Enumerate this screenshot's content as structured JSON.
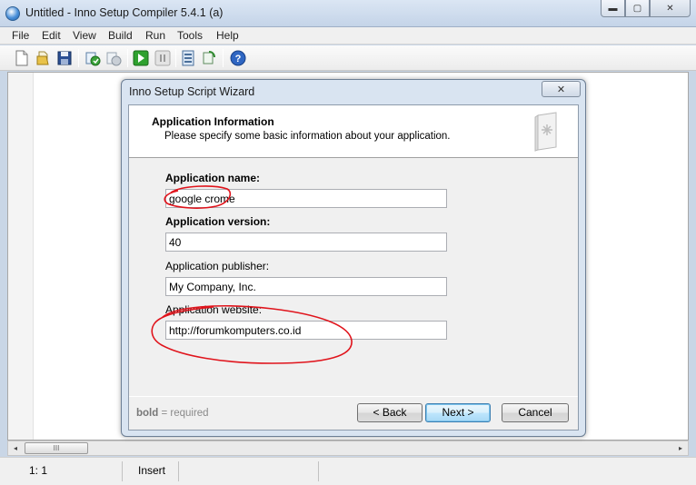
{
  "window": {
    "title": "Untitled - Inno Setup Compiler 5.4.1 (a)",
    "min_glyph": "▬",
    "max_glyph": "▢",
    "close_glyph": "✕"
  },
  "menu": [
    "File",
    "Edit",
    "View",
    "Build",
    "Run",
    "Tools",
    "Help"
  ],
  "toolbar": {
    "icons": [
      "new-file-icon",
      "open-folder-icon",
      "save-icon",
      "compile-icon",
      "stop-compile-icon",
      "run-icon",
      "pause-icon",
      "target-setup-icon",
      "target-uninstall-icon",
      "help-icon"
    ]
  },
  "scrollbar": {
    "left_arrow": "◂",
    "right_arrow": "▸",
    "thumb_grip": "III"
  },
  "status": {
    "position": "1:   1",
    "mode": "Insert"
  },
  "wizard": {
    "title": "Inno Setup Script Wizard",
    "close_glyph": "✕",
    "header_title": "Application Information",
    "header_subtitle": "Please specify some basic information about your application.",
    "fields": {
      "app_name_label": "Application name:",
      "app_name_value": "google crome",
      "app_version_label": "Application version:",
      "app_version_value": "40",
      "app_publisher_label": "Application publisher:",
      "app_publisher_value": "My Company, Inc.",
      "app_website_label": "Application website:",
      "app_website_value": "http://forumkomputers.co.id"
    },
    "hint_bold": "bold",
    "hint_rest": " = required",
    "buttons": {
      "back": "< Back",
      "next": "Next >",
      "cancel": "Cancel"
    }
  },
  "colors": {
    "annotation_red": "#e0141c",
    "default_button_border": "#3c7fb1"
  }
}
